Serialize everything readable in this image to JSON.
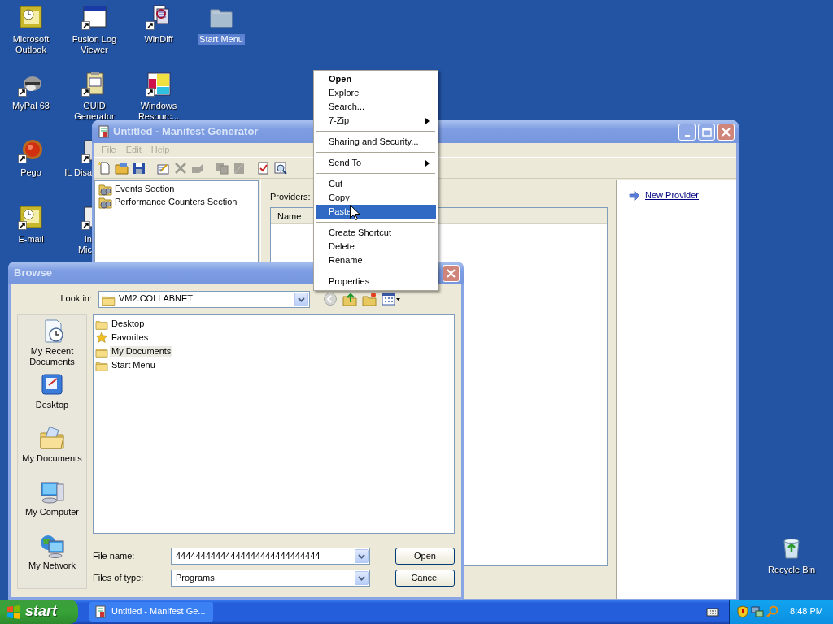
{
  "desktop_icons": [
    {
      "label": "Microsoft Outlook",
      "kind": "full",
      "selected": false
    },
    {
      "label": "Fusion Log Viewer",
      "kind": "full",
      "selected": false
    },
    {
      "label": "WinDiff",
      "kind": "full",
      "selected": false
    },
    {
      "label": "Start Menu",
      "kind": "full",
      "selected": true
    },
    {
      "label": "MyPal 68",
      "kind": "full",
      "selected": false
    },
    {
      "label": "GUID Generator",
      "kind": "full",
      "selected": false
    },
    {
      "label": "Windows Resourc...",
      "kind": "full",
      "selected": false
    },
    {
      "label": "Pego",
      "kind": "full",
      "selected": false
    },
    {
      "label": "IL Disa",
      "kind": "covered",
      "selected": false
    },
    {
      "label": "E-mail",
      "kind": "full",
      "selected": false
    },
    {
      "label": "In\nMic",
      "kind": "covered",
      "selected": false
    },
    {
      "label": "Recycle Bin",
      "kind": "full",
      "selected": false
    }
  ],
  "manifest_window": {
    "title": "Untitled - Manifest Generator",
    "active": false,
    "menu": [
      {
        "label": "File",
        "disabled": true
      },
      {
        "label": "Edit",
        "disabled": true
      },
      {
        "label": "Help",
        "disabled": true
      }
    ],
    "tree": [
      {
        "label": "Events Section"
      },
      {
        "label": "Performance Counters Section"
      }
    ],
    "providers_label": "Providers:",
    "columns": [
      "Name"
    ],
    "task_link": "New Provider"
  },
  "browse_dialog": {
    "title": "Browse",
    "active": false,
    "look_in_label": "Look in:",
    "look_in": "VM2.COLLABNET",
    "places": [
      {
        "label": "My Recent Documents"
      },
      {
        "label": "Desktop"
      },
      {
        "label": "My Documents"
      },
      {
        "label": "My Computer"
      },
      {
        "label": "My Network"
      }
    ],
    "files": [
      {
        "name": "Desktop",
        "kind": "folder",
        "hovered": false
      },
      {
        "name": "Favorites",
        "kind": "favorites",
        "hovered": false
      },
      {
        "name": "My Documents",
        "kind": "folder",
        "hovered": true
      },
      {
        "name": "Start Menu",
        "kind": "folder",
        "hovered": false
      }
    ],
    "file_name_label": "File name:",
    "file_name": "44444444444444444444444444444",
    "type_label": "Files of type:",
    "file_type": "Programs",
    "buttons": [
      "Open",
      "Cancel"
    ]
  },
  "context_menu": {
    "items": [
      {
        "kind": "item",
        "label": "Open",
        "default": true,
        "submenu": false,
        "selected": false
      },
      {
        "kind": "item",
        "label": "Explore",
        "default": false,
        "submenu": false,
        "selected": false
      },
      {
        "kind": "item",
        "label": "Search...",
        "default": false,
        "submenu": false,
        "selected": false
      },
      {
        "kind": "item",
        "label": "7-Zip",
        "default": false,
        "submenu": true,
        "selected": false
      },
      {
        "kind": "separator"
      },
      {
        "kind": "item",
        "label": "Sharing and Security...",
        "default": false,
        "submenu": false,
        "selected": false
      },
      {
        "kind": "separator"
      },
      {
        "kind": "item",
        "label": "Send To",
        "default": false,
        "submenu": true,
        "selected": false
      },
      {
        "kind": "separator"
      },
      {
        "kind": "item",
        "label": "Cut",
        "default": false,
        "submenu": false,
        "selected": false
      },
      {
        "kind": "item",
        "label": "Copy",
        "default": false,
        "submenu": false,
        "selected": false
      },
      {
        "kind": "item",
        "label": "Paste",
        "default": false,
        "submenu": false,
        "selected": true
      },
      {
        "kind": "separator"
      },
      {
        "kind": "item",
        "label": "Create Shortcut",
        "default": false,
        "submenu": false,
        "selected": false
      },
      {
        "kind": "item",
        "label": "Delete",
        "default": false,
        "submenu": false,
        "selected": false
      },
      {
        "kind": "item",
        "label": "Rename",
        "default": false,
        "submenu": false,
        "selected": false
      },
      {
        "kind": "separator"
      },
      {
        "kind": "item",
        "label": "Properties",
        "default": false,
        "submenu": false,
        "selected": false
      }
    ]
  },
  "taskbar": {
    "start": "start",
    "tasks": [
      {
        "label": "Untitled - Manifest Ge...",
        "selected": false
      }
    ],
    "clock": "8:48 PM"
  }
}
